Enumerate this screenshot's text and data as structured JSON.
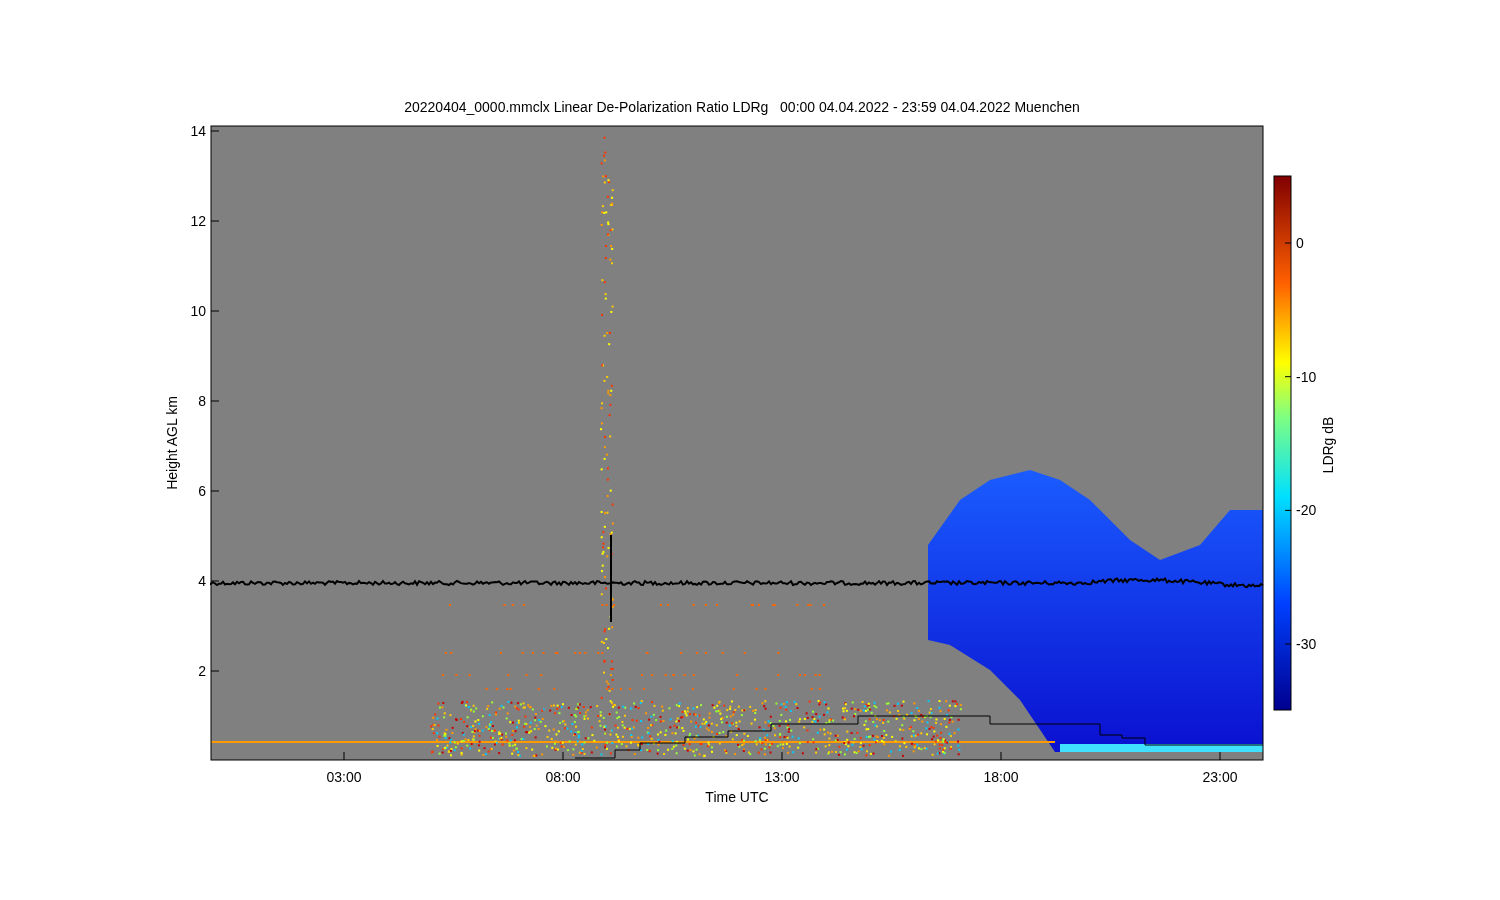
{
  "title": "20220404_0000.mmclx Linear De-Polarization Ratio LDRg   00:00 04.04.2022 - 23:59 04.04.2022 Muenchen",
  "plot": {
    "ylabel": "Height AGL km",
    "xlabel": "Time UTC",
    "yticks": [
      "14",
      "12",
      "10",
      "8",
      "6",
      "4",
      "2"
    ],
    "xticks": [
      "03:00",
      "08:00",
      "13:00",
      "18:00",
      "23:00"
    ]
  },
  "colorbar": {
    "label": "LDRg dB",
    "ticks": [
      "0",
      "-10",
      "-20",
      "-30"
    ]
  }
}
